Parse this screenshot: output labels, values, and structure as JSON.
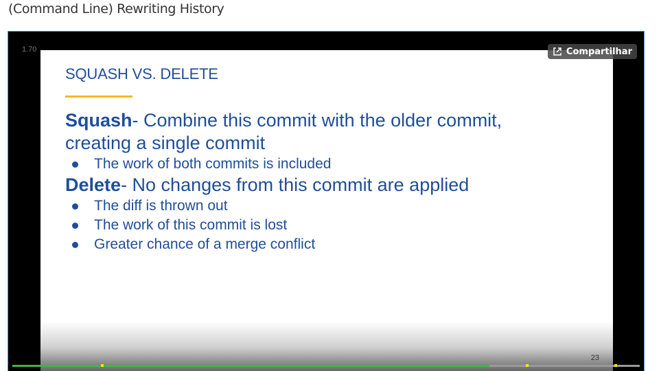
{
  "page": {
    "title": "(Command Line) Rewriting History"
  },
  "player": {
    "speed": "1.70",
    "share_label": "Compartilhar",
    "share_icon": "share-icon",
    "progress": {
      "played_fraction": 0.76,
      "played_color": "#3fb54a",
      "remaining_color": "#9a9a9a",
      "marker_color": "#ffe500",
      "marker_fractions": [
        0.141,
        0.818,
        0.959
      ]
    }
  },
  "slide": {
    "heading": "SQUASH VS. DELETE",
    "accent_color": "#f4b728",
    "text_color": "#1f4e9a",
    "squash": {
      "term": "Squash",
      "definition_line1": "- Combine this commit with the older commit,",
      "definition_line2": "creating a single commit",
      "bullets": [
        "The work of both commits is included"
      ]
    },
    "delete": {
      "term": "Delete",
      "definition": "- No changes from this commit are applied",
      "bullets": [
        "The diff is thrown out",
        "The work of this commit is lost",
        "Greater chance of a merge conflict"
      ]
    },
    "number": "23"
  }
}
